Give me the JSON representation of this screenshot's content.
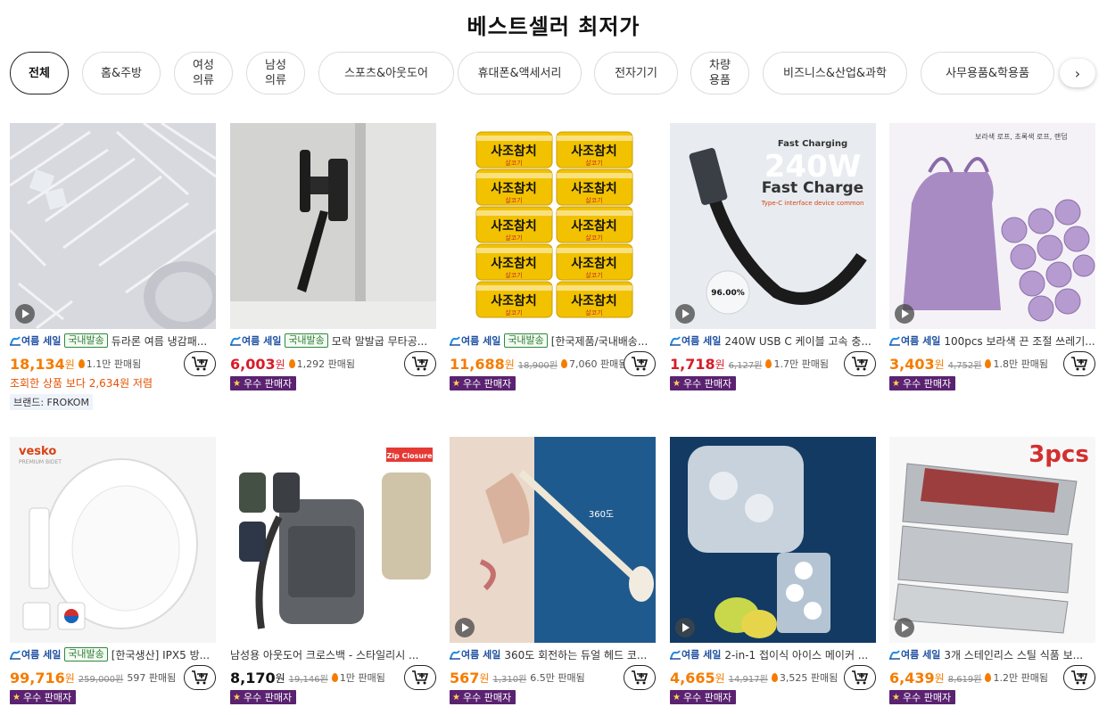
{
  "page": {
    "title": "베스트셀러 최저가"
  },
  "categories": [
    {
      "label": "전체",
      "active": true
    },
    {
      "label": "홈&주방"
    },
    {
      "label": "여성\n의류"
    },
    {
      "label": "남성\n의류"
    },
    {
      "label": "스포츠&아웃도어"
    },
    {
      "label": "휴대폰&액세서리"
    },
    {
      "label": "전자기기"
    },
    {
      "label": "차량\n용품"
    },
    {
      "label": "비즈니스&산업&과학"
    },
    {
      "label": "사무용품&학용품"
    }
  ],
  "labels": {
    "sale_badge": "여름 세일",
    "domestic_badge": "국내발송",
    "seller_badge": "우수 판매자",
    "won": "원",
    "sold_suffix": "판매됨"
  },
  "colors": {
    "seller_bg": "#5a2270",
    "price_orange": "#f57c00",
    "price_red": "#d81b28",
    "domestic_green": "#2e7d32"
  },
  "products": [
    {
      "name": "듀라론 여름 냉감패...",
      "price": "18,134",
      "original": "",
      "sold": "1.1만",
      "sale": true,
      "domestic": true,
      "seller": false,
      "video": true,
      "price_color": "orange",
      "compare": "조회한 상품 보다 2,634원 저렴",
      "brand": "브랜드: FROKOM"
    },
    {
      "name": "모락 말발굽 무타공...",
      "price": "6,003",
      "original": "",
      "sold": "1,292",
      "sale": true,
      "domestic": true,
      "seller": true,
      "video": false,
      "price_color": "red"
    },
    {
      "name": "[한국제품/국내배송...",
      "price": "11,688",
      "original": "18,900원",
      "sold": "7,060",
      "sale": true,
      "domestic": true,
      "seller": true,
      "video": false,
      "price_color": "orange"
    },
    {
      "name": "240W USB C 케이블 고속 충...",
      "price": "1,718",
      "original": "6,127원",
      "sold": "1.7만",
      "sale": true,
      "domestic": false,
      "seller": true,
      "video": true,
      "price_color": "red"
    },
    {
      "name": "100pcs 보라색 끈 조절 쓰레기...",
      "price": "3,403",
      "original": "4,752원",
      "sold": "1.8만",
      "sale": true,
      "domestic": false,
      "seller": true,
      "video": true,
      "price_color": "orange"
    },
    {
      "name": "[한국생산] IPX5 방...",
      "price": "99,716",
      "original": "259,000원",
      "sold": "597",
      "sale": true,
      "domestic": true,
      "seller": true,
      "video": false,
      "price_color": "orange",
      "no_flame": true
    },
    {
      "name": "남성용 아웃도어 크로스백 - 스타일리시 ...",
      "price": "8,170",
      "original": "19,146원",
      "sold": "1만",
      "sale": false,
      "domestic": false,
      "seller": true,
      "video": false,
      "price_color": "black"
    },
    {
      "name": "360도 회전하는 듀얼 헤드 코...",
      "price": "567",
      "original": "1,310원",
      "sold": "6.5만",
      "sale": true,
      "domestic": false,
      "seller": true,
      "video": true,
      "price_color": "orange",
      "no_flame": true
    },
    {
      "name": "2-in-1 접이식 아이스 메이커 ...",
      "price": "4,665",
      "original": "14,917원",
      "sold": "3,525",
      "sale": true,
      "domestic": false,
      "seller": true,
      "video": true,
      "price_color": "orange"
    },
    {
      "name": "3개 스테인리스 스틸 식품 보...",
      "price": "6,439",
      "original": "8,619원",
      "sold": "1.2만",
      "sale": true,
      "domestic": false,
      "seller": true,
      "video": true,
      "price_color": "orange"
    }
  ],
  "image_text": {
    "p2_tuna": "사조참치",
    "p2_tuna_sub": "살코기",
    "p3_watts": "240W",
    "p3_fast": "Fast Charge",
    "p3_tag": "Fast Charging",
    "p3_sub": "Type-C interface device common",
    "p3_pct": "96.00%",
    "p4_text": "보라색 로프, 초록색 로프, 랜덤",
    "p5_brand": "vesko",
    "p5_brand_sub": "PREMIUM BIDET",
    "p6_zip": "Zip Closure",
    "p7_deg": "360도",
    "p9_3pcs": "3pcs"
  }
}
